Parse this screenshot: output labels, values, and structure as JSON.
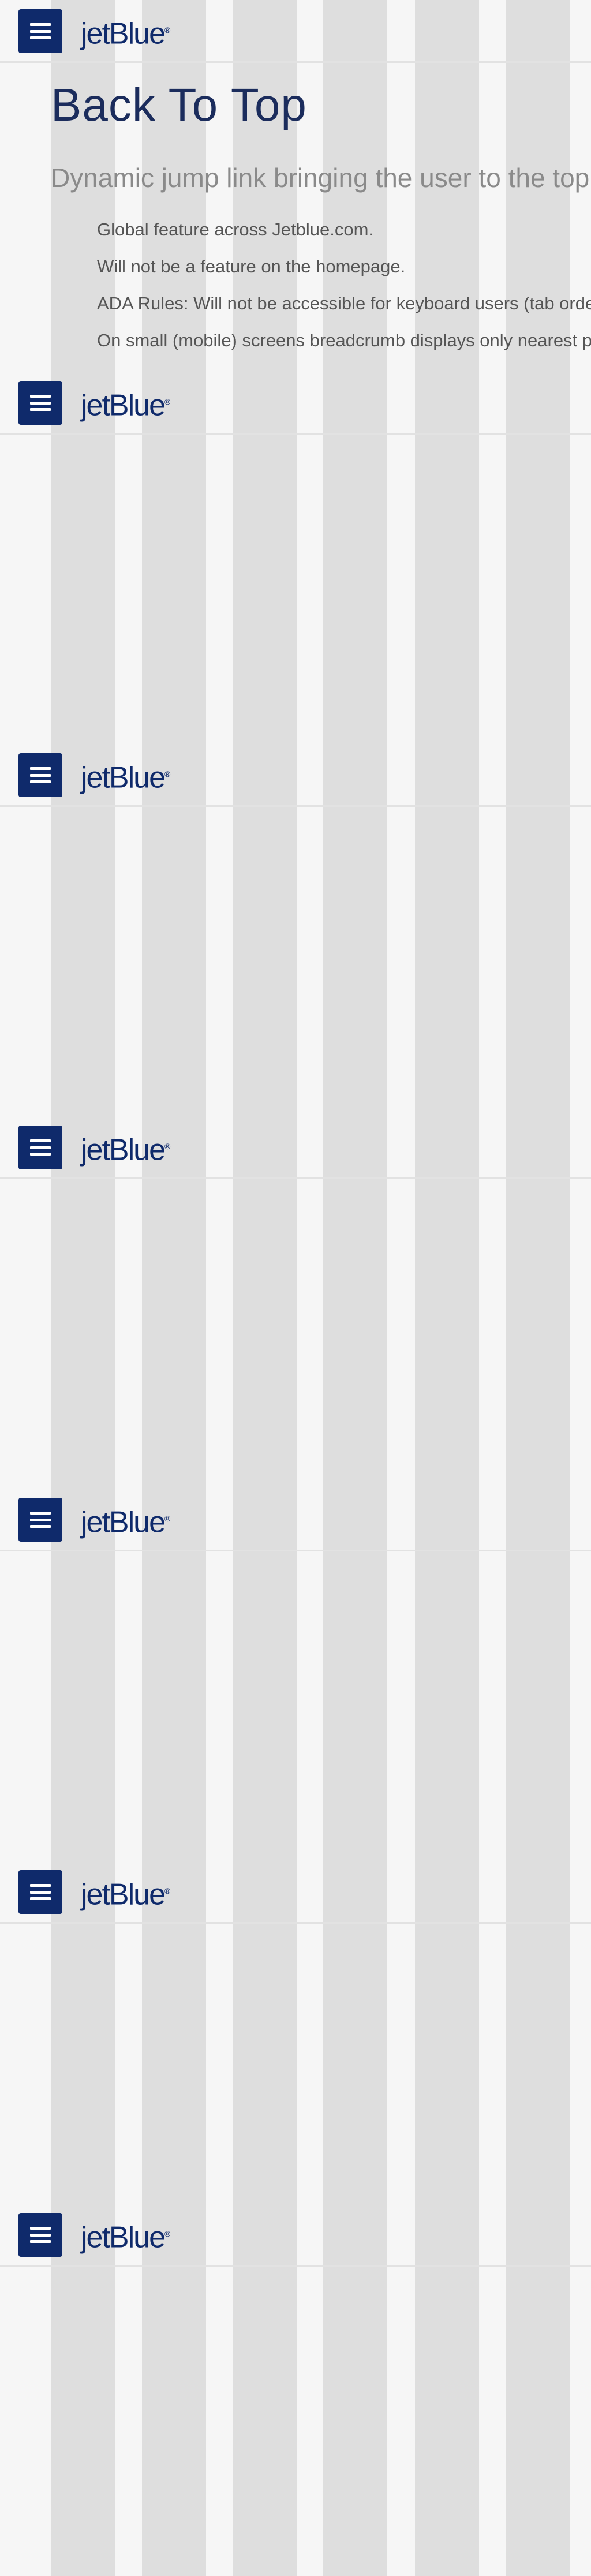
{
  "header": {
    "logo_text": "jetBlue",
    "logo_mark": "®",
    "menu_icon": "hamburger-menu-icon"
  },
  "page": {
    "title": "Back To Top",
    "subtitle": "Dynamic jump link bringing the user to the top of the page.",
    "bullets": [
      "Global feature across Jetblue.com.",
      "Will not be a feature on the homepage.",
      "ADA Rules: Will not be accessible for keyboard users (tab order)",
      "On small (mobile) screens breadcrumb displays only nearest parent page"
    ]
  },
  "colors": {
    "brand_navy": "#0f2a6b",
    "title_navy": "#1b2c5c",
    "subtitle_gray": "#8a8a8a",
    "body_gray": "#555555",
    "grid_column": "#dedede",
    "background": "#f6f6f6"
  }
}
